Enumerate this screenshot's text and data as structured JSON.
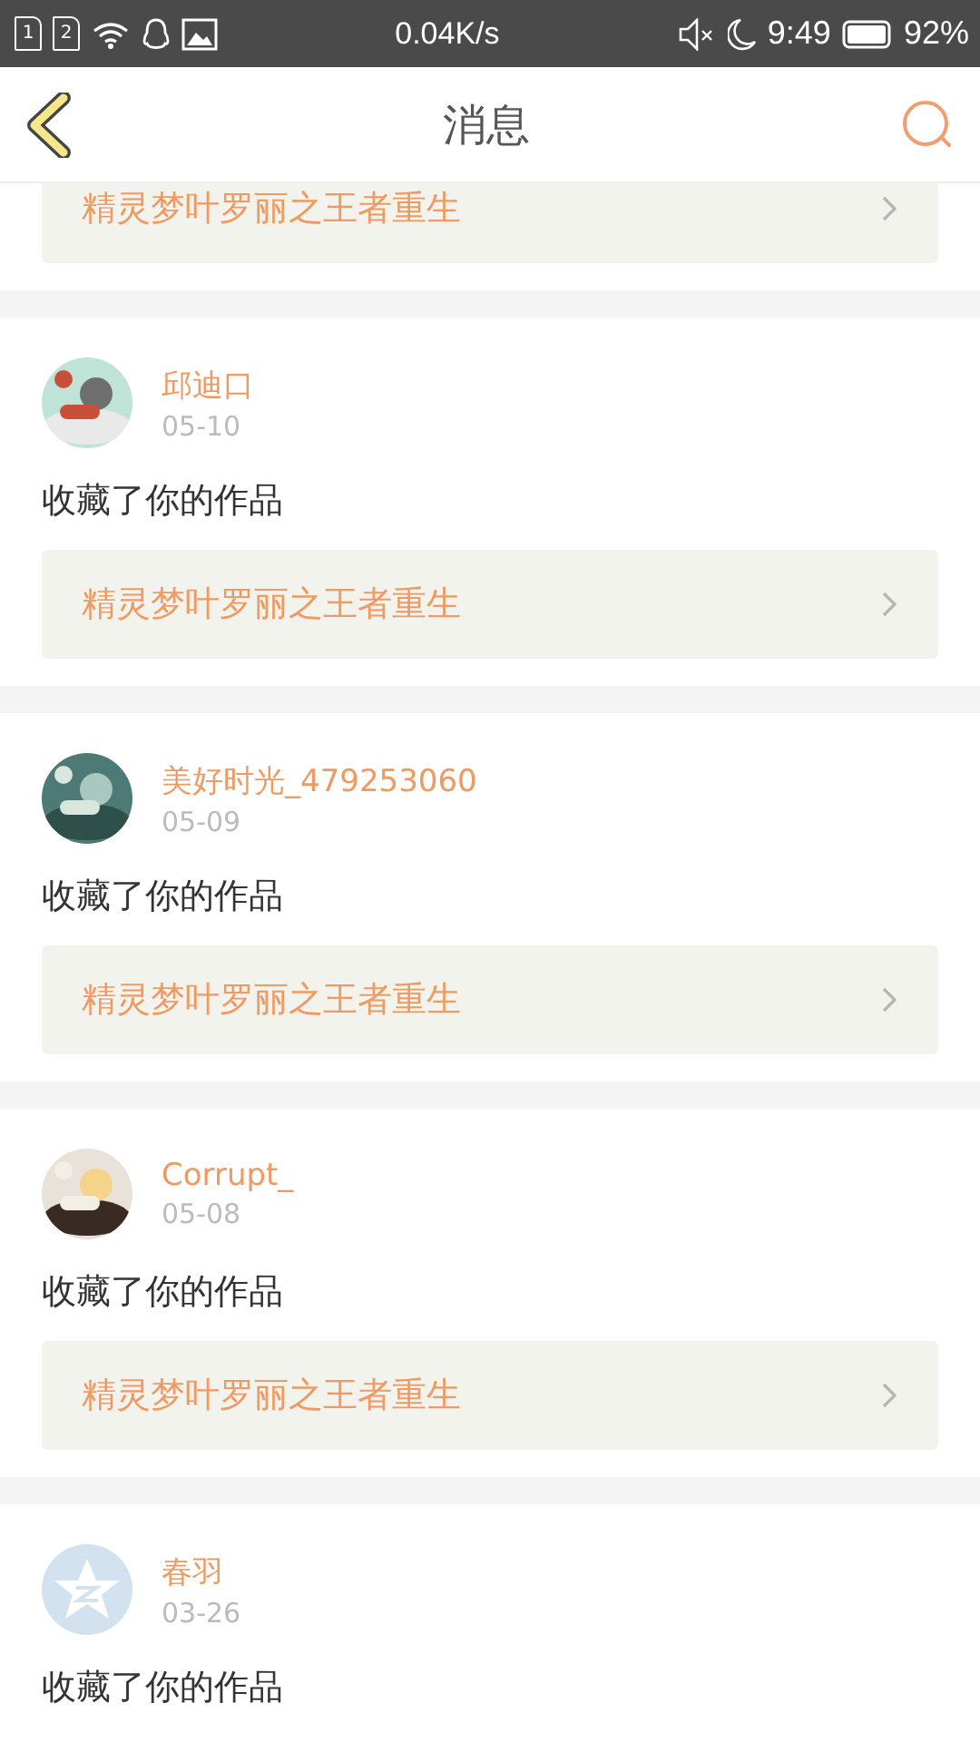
{
  "status_bar": {
    "sims": [
      "1",
      "2"
    ],
    "speed": "0.04K/s",
    "time": "9:49",
    "battery": "92%"
  },
  "header": {
    "title": "消息"
  },
  "partial_top": {
    "work": "精灵梦叶罗丽之王者重生"
  },
  "messages": [
    {
      "name": "邱迪口",
      "date": "05-10",
      "action": "收藏了你的作品",
      "work": "精灵梦叶罗丽之王者重生"
    },
    {
      "name": "美好时光_479253060",
      "date": "05-09",
      "action": "收藏了你的作品",
      "work": "精灵梦叶罗丽之王者重生"
    },
    {
      "name": "Corrupt_",
      "date": "05-08",
      "action": "收藏了你的作品",
      "work": "精灵梦叶罗丽之王者重生"
    },
    {
      "avatar": {
        "kind": "default"
      },
      "name": "春羽",
      "date": "03-26",
      "action": "收藏了你的作品"
    }
  ]
}
